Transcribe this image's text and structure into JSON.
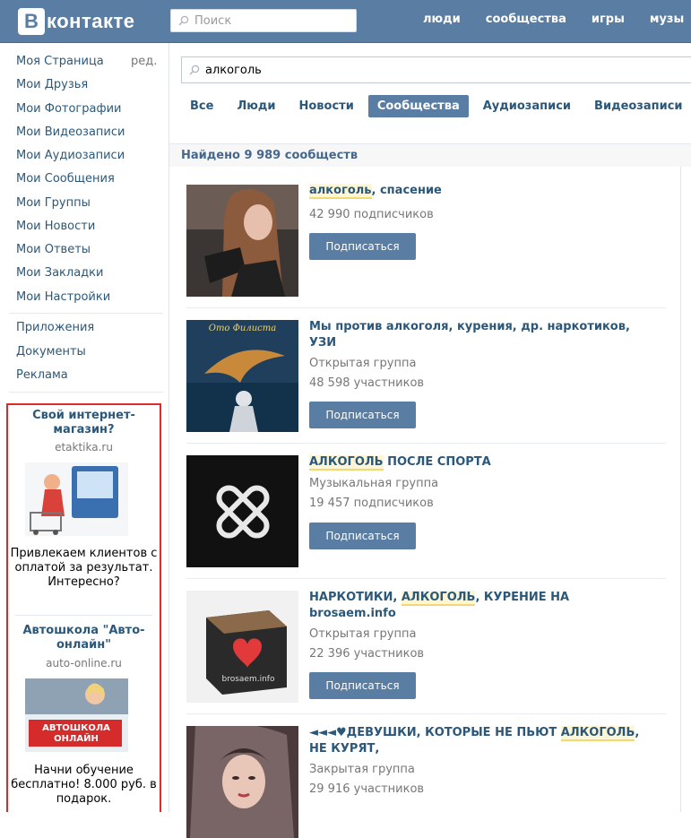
{
  "header": {
    "logo_letter": "В",
    "logo_text": "контакте",
    "search_placeholder": "Поиск",
    "nav": [
      "люди",
      "сообщества",
      "игры",
      "музы"
    ]
  },
  "sidebar": {
    "items": [
      "Моя Страница",
      "Мои Друзья",
      "Мои Фотографии",
      "Мои Видеозаписи",
      "Мои Аудиозаписи",
      "Мои Сообщения",
      "Мои Группы",
      "Мои Новости",
      "Мои Ответы",
      "Мои Закладки",
      "Мои Настройки"
    ],
    "edit_label": "ред.",
    "extra_items": [
      "Приложения",
      "Документы",
      "Реклама"
    ]
  },
  "ads": [
    {
      "title": "Свой интернет-магазин?",
      "domain": "etaktika.ru",
      "text": "Привлекаем клиентов с оплатой за результат. Интересно?"
    },
    {
      "title": "Автошкола \"Авто-онлайн\"",
      "domain": "auto-online.ru",
      "image_text": "АВТОШКОЛА ОНЛАЙН",
      "text": "Начни обучение бесплатно! 8.000 руб. в подарок."
    }
  ],
  "search": {
    "query": "алкоголь"
  },
  "tabs": [
    "Все",
    "Люди",
    "Новости",
    "Сообщества",
    "Аудиозаписи",
    "Видеозаписи"
  ],
  "active_tab": "Сообщества",
  "found_text": "Найдено 9 989 сообществ",
  "subscribe_label": "Подписаться",
  "results": [
    {
      "title_parts": [
        [
          "алкоголь",
          true
        ],
        [
          ", спасение",
          false
        ]
      ],
      "type": "",
      "count": "42 990 подписчиков"
    },
    {
      "title_line1": "Мы против алкоголя, курения, др. наркотиков,",
      "title_line2": "УЗИ",
      "image_caption": "Ото Филиста",
      "type": "Открытая группа",
      "count": "48 598 участников"
    },
    {
      "title_parts": [
        [
          "АЛКОГОЛЬ",
          true
        ],
        [
          " ПОСЛЕ СПОРТА",
          false
        ]
      ],
      "type": "Музыкальная группа",
      "count": "19 457 подписчиков"
    },
    {
      "title_line1_parts": [
        [
          "НАРКОТИКИ, ",
          false
        ],
        [
          "АЛКОГОЛЬ",
          true
        ],
        [
          ", КУРЕНИЕ НА",
          false
        ]
      ],
      "title_line2": "brosaem.info",
      "image_caption": "brosaem.info",
      "type": "Открытая группа",
      "count": "22 396 участников"
    },
    {
      "title_line1_parts": [
        [
          "◄◄◄♥ДЕВУШКИ, КОТОРЫЕ НЕ ПЬЮТ ",
          false
        ],
        [
          "АЛКОГОЛЬ",
          true
        ],
        [
          ",",
          false
        ]
      ],
      "title_line2": "НЕ КУРЯТ,",
      "type": "Закрытая группа",
      "count": "29 916 участников"
    }
  ],
  "colors": {
    "header_bg": "#597da3",
    "link": "#2b587a",
    "button": "#597da3",
    "ad_border": "#dd2a2a",
    "highlight": "#fdf6d6"
  }
}
